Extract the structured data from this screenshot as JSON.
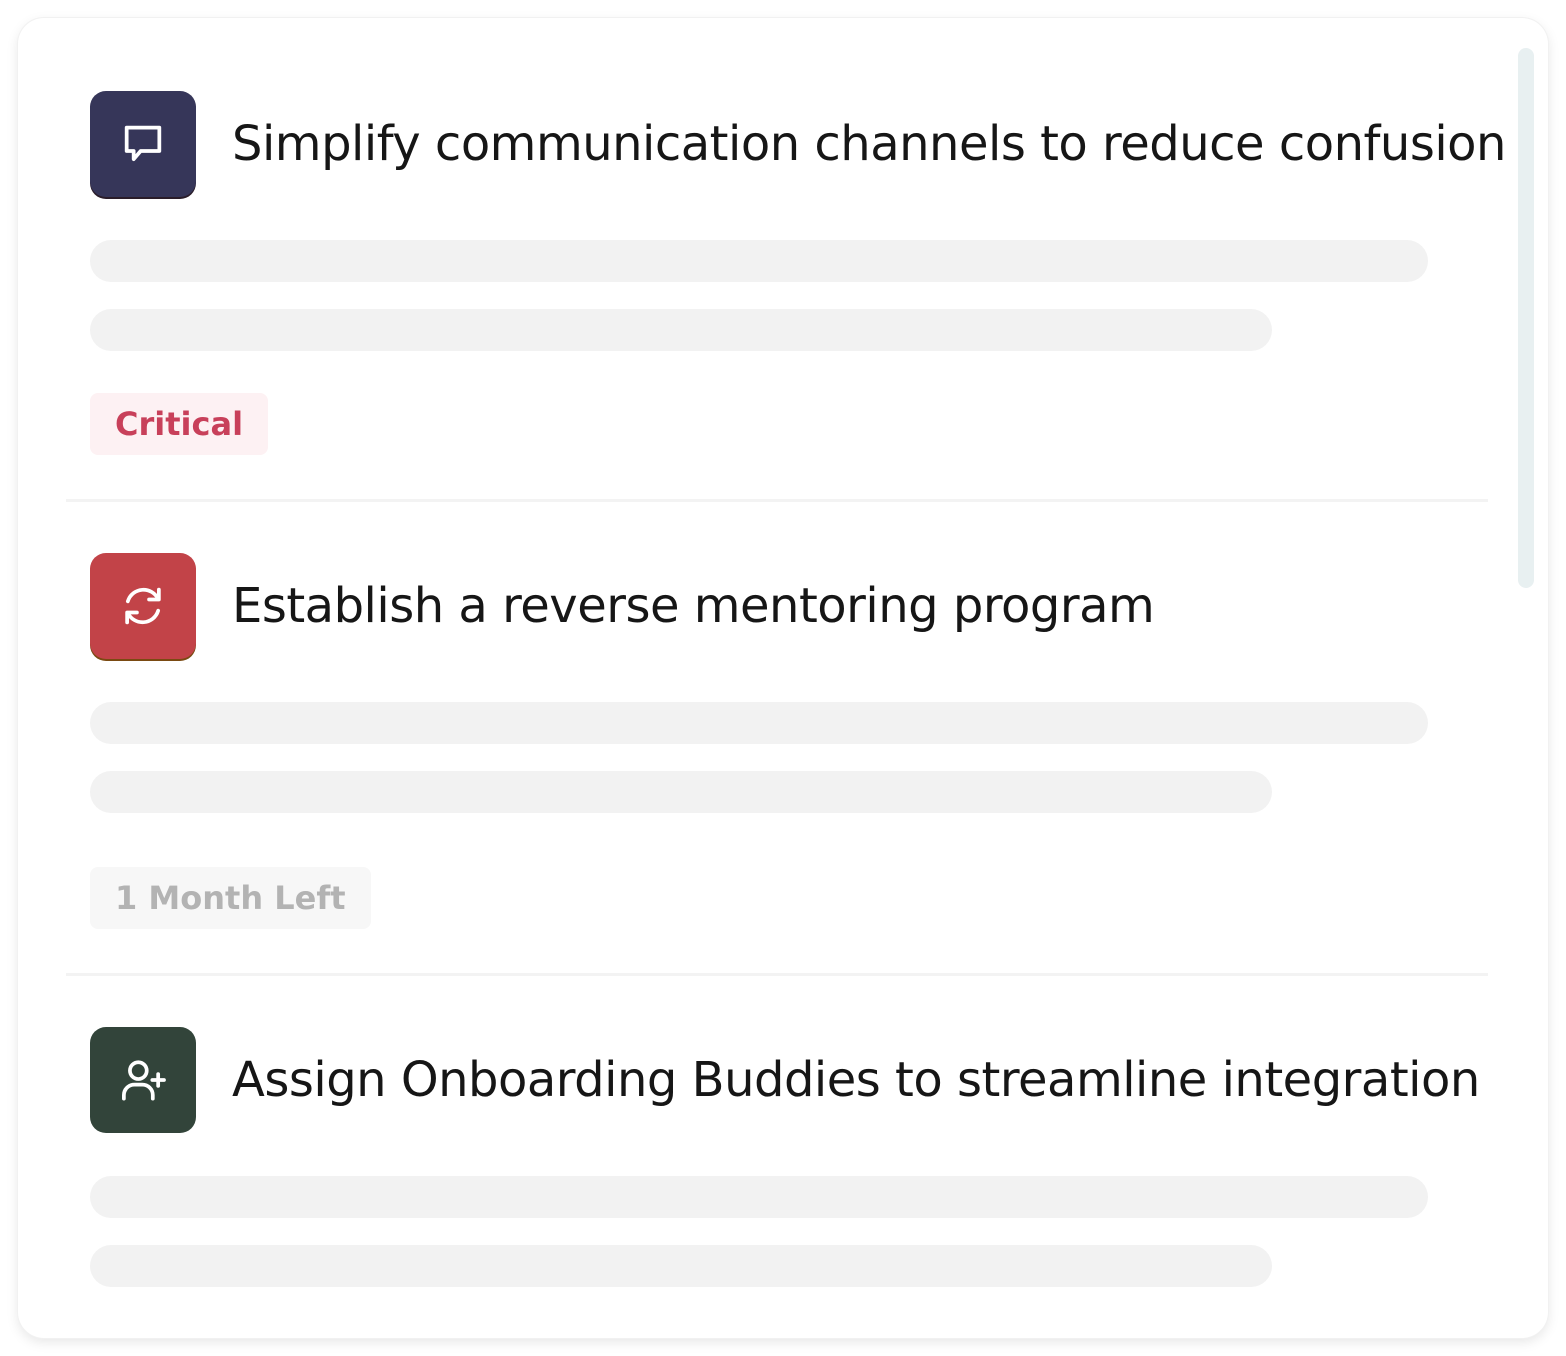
{
  "items": [
    {
      "icon": "speech-bubble-icon",
      "icon_bg": "#363659",
      "title": "Simplify communication channels to reduce confusion",
      "tag": {
        "label": "Critical",
        "color": "#c8405a",
        "bg": "#fdf1f3"
      }
    },
    {
      "icon": "refresh-arrows-icon",
      "icon_bg": "#c24348",
      "title": "Establish a reverse mentoring program",
      "tag": {
        "label": "1 Month Left",
        "color": "#b3b3b3",
        "bg": "#f7f7f7"
      }
    },
    {
      "icon": "add-user-icon",
      "icon_bg": "#32443a",
      "title": "Assign Onboarding Buddies to streamline integration"
    }
  ]
}
